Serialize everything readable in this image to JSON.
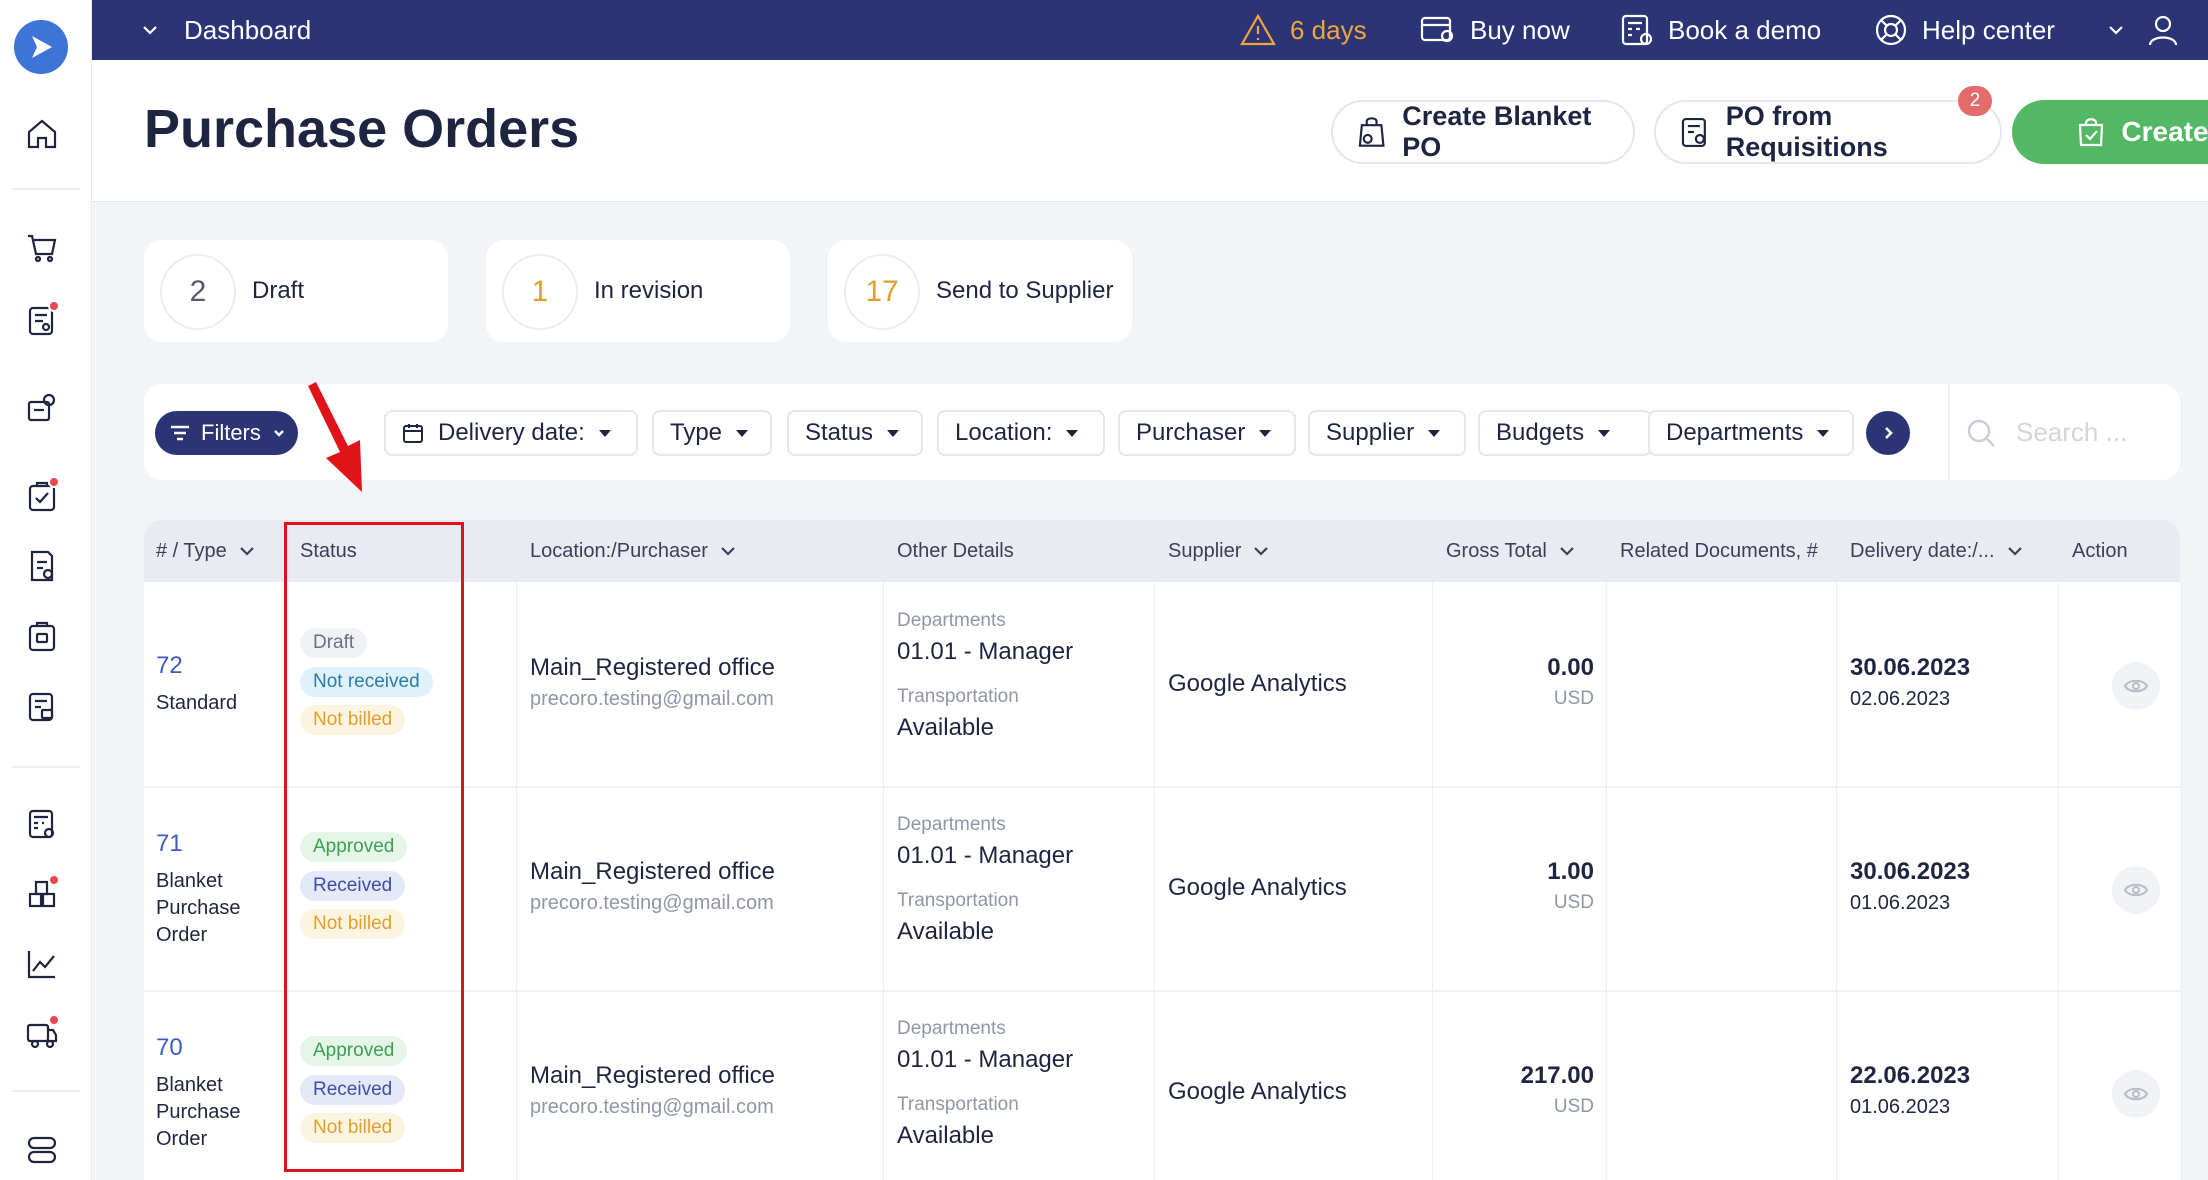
{
  "topbar": {
    "dashboard": "Dashboard",
    "trial": "6 days",
    "buy": "Buy now",
    "demo": "Book a demo",
    "help": "Help center"
  },
  "header": {
    "title": "Purchase Orders",
    "blanket_btn": "Create Blanket PO",
    "req_btn": "PO from Requisitions",
    "req_badge": "2",
    "create_btn": "Create"
  },
  "summary": [
    {
      "count": "2",
      "label": "Draft",
      "color": "#555a6e"
    },
    {
      "count": "1",
      "label": "In revision",
      "color": "#e0a02b"
    },
    {
      "count": "17",
      "label": "Send to Supplier",
      "color": "#e0a02b"
    }
  ],
  "filters": {
    "filters_btn": "Filters",
    "chips": [
      "Delivery date:",
      "Type",
      "Status",
      "Location:",
      "Purchaser",
      "Supplier",
      "Budgets",
      "Departments"
    ],
    "search_placeholder": "Search ..."
  },
  "columns": [
    "# / Type",
    "Status",
    "Location:/Purchaser",
    "Other Details",
    "Supplier",
    "Gross Total",
    "Related Documents, #",
    "Delivery date:/...",
    "Action"
  ],
  "rows": [
    {
      "number": "72",
      "type_lines": [
        "Standard"
      ],
      "statuses": [
        {
          "text": "Draft",
          "kind": "grey"
        },
        {
          "text": "Not received",
          "kind": "blue"
        },
        {
          "text": "Not billed",
          "kind": "orange"
        }
      ],
      "location": "Main_Registered office",
      "email": "precoro.testing@gmail.com",
      "dept_label": "Departments",
      "dept_value": "01.01 - Manager",
      "transport_label": "Transportation",
      "transport_value": "Available",
      "supplier": "Google Analytics",
      "amount": "0.00",
      "currency": "USD",
      "date1": "30.06.2023",
      "date2": "02.06.2023"
    },
    {
      "number": "71",
      "type_lines": [
        "Blanket",
        "Purchase",
        "Order"
      ],
      "statuses": [
        {
          "text": "Approved",
          "kind": "green"
        },
        {
          "text": "Received",
          "kind": "indigo"
        },
        {
          "text": "Not billed",
          "kind": "orange"
        }
      ],
      "location": "Main_Registered office",
      "email": "precoro.testing@gmail.com",
      "dept_label": "Departments",
      "dept_value": "01.01 - Manager",
      "transport_label": "Transportation",
      "transport_value": "Available",
      "supplier": "Google Analytics",
      "amount": "1.00",
      "currency": "USD",
      "date1": "30.06.2023",
      "date2": "01.06.2023"
    },
    {
      "number": "70",
      "type_lines": [
        "Blanket",
        "Purchase",
        "Order"
      ],
      "statuses": [
        {
          "text": "Approved",
          "kind": "green"
        },
        {
          "text": "Received",
          "kind": "indigo"
        },
        {
          "text": "Not billed",
          "kind": "orange"
        }
      ],
      "location": "Main_Registered office",
      "email": "precoro.testing@gmail.com",
      "dept_label": "Departments",
      "dept_value": "01.01 - Manager",
      "transport_label": "Transportation",
      "transport_value": "Available",
      "supplier": "Google Analytics",
      "amount": "217.00",
      "currency": "USD",
      "date1": "22.06.2023",
      "date2": "01.06.2023"
    }
  ],
  "colors": {
    "nav": "#2b3576",
    "create": "#52b863",
    "annotation": "#e0131b",
    "trial_warning": "#f0a53a"
  }
}
